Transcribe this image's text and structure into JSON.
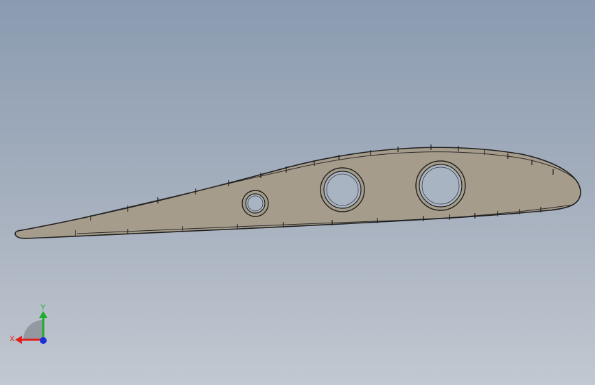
{
  "viewport": {
    "background_top": "#8a9bb0",
    "background_bottom": "#c2c8d1"
  },
  "part": {
    "name": "airfoil-rib",
    "face_color": "#a59c8b",
    "edge_color": "#1e1e1e",
    "hole_fill": "#a9b4c2",
    "hole_count": 3
  },
  "triad": {
    "x_label": "X",
    "y_label": "Y",
    "x_color": "#e0201a",
    "y_color": "#1fae2a",
    "z_color": "#1a2fd8"
  }
}
